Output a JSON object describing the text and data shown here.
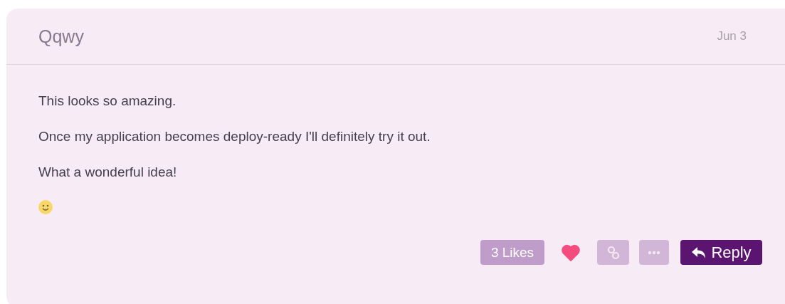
{
  "post": {
    "author": "Qqwy",
    "date": "Jun 3",
    "paragraphs": [
      "This looks so amazing.",
      "Once my application becomes deploy-ready I'll definitely try it out.",
      "What a wonderful idea!"
    ],
    "likes": "3 Likes",
    "liked": true,
    "reply": "Reply"
  }
}
